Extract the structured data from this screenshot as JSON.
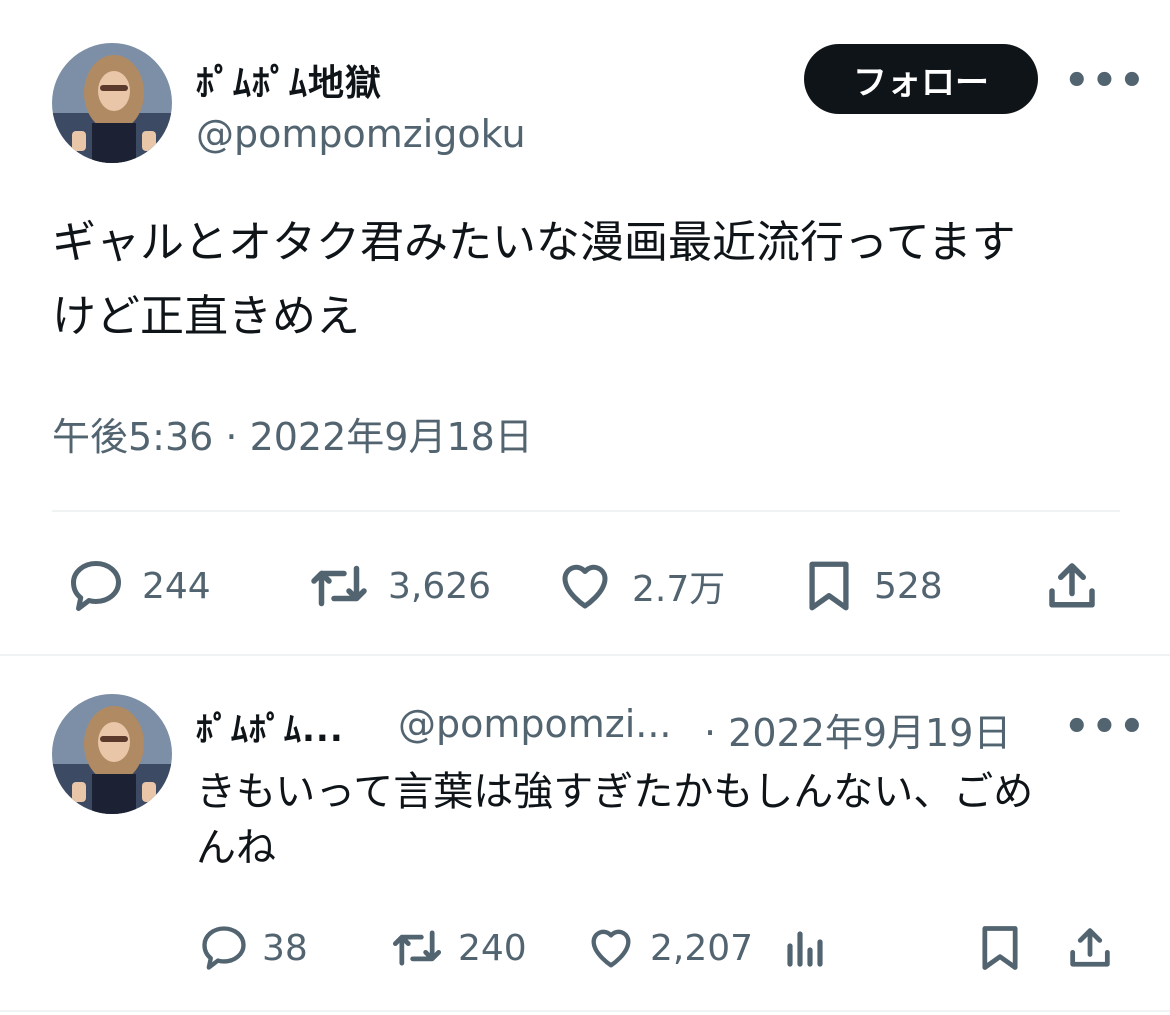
{
  "tweet": {
    "author_name": "ﾎﾟﾑﾎﾟﾑ地獄",
    "author_handle": "@pompomzigoku",
    "follow_label": "フォロー",
    "more_label": "•••",
    "text_line1": "ギャルとオタク君みたいな漫画最近流行ってます",
    "text_line2": "けど正直きめえ",
    "timestamp": "午後5:36 · 2022年9月18日",
    "stats": {
      "replies": "244",
      "retweets": "3,626",
      "likes": "2.7万",
      "bookmarks": "528"
    },
    "icons": [
      "reply-icon",
      "retweet-icon",
      "like-icon",
      "bookmark-icon",
      "share-icon"
    ]
  },
  "reply": {
    "author_name": "ﾎﾟﾑﾎﾟﾑ...",
    "author_handle": "@pompomzi...",
    "date": "· 2022年9月19日",
    "more_label": "•••",
    "text_line1": "きもいって言葉は強すぎたかもしんない、ごめ",
    "text_line2": "んね",
    "stats": {
      "replies": "38",
      "retweets": "240",
      "likes": "2,207"
    },
    "icons": [
      "reply-icon",
      "retweet-icon",
      "like-icon",
      "views-icon",
      "bookmark-icon",
      "share-icon"
    ]
  },
  "colors": {
    "text": "#0f1419",
    "secondary": "#536471",
    "divider": "#eff3f4",
    "button": "#0f1419"
  }
}
